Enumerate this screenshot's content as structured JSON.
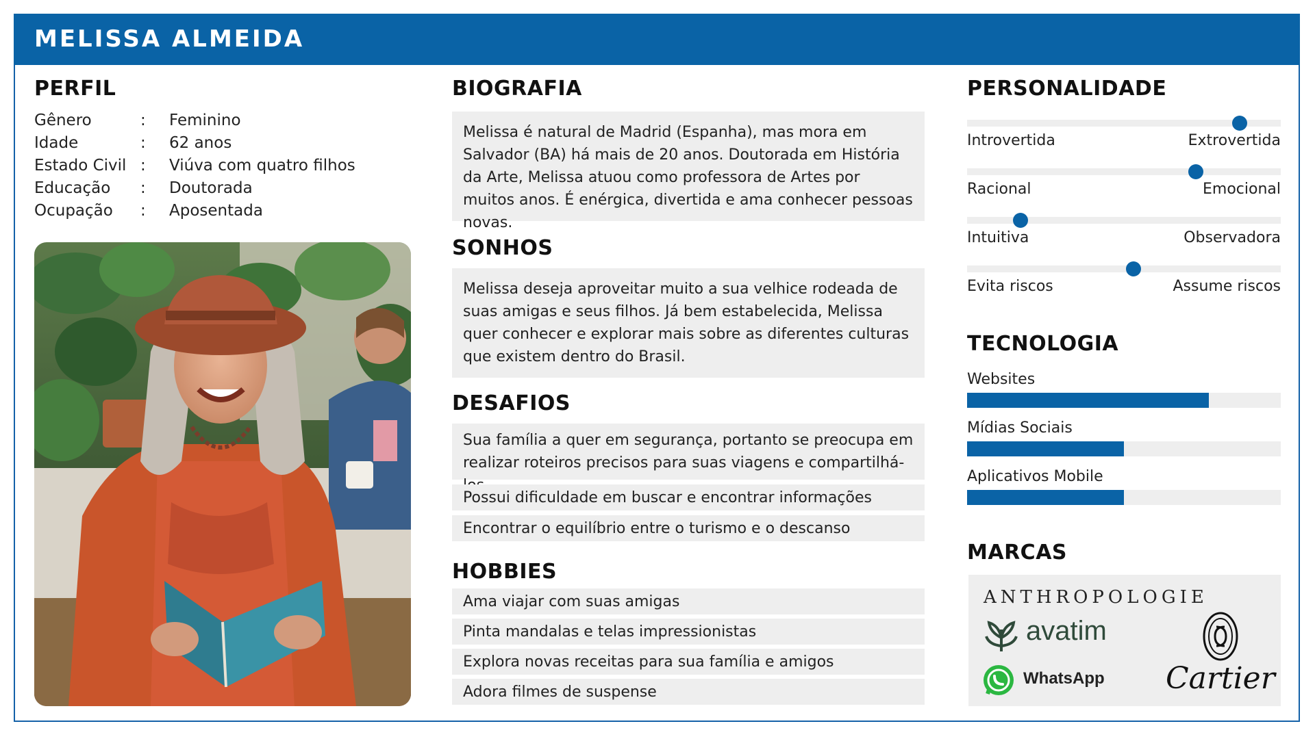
{
  "persona": {
    "name": "MELISSA ALMEIDA"
  },
  "profile": {
    "title": "PERFIL",
    "rows": [
      {
        "label": "Gênero",
        "colon": ":",
        "value": "Feminino"
      },
      {
        "label": "Idade",
        "colon": ":",
        "value": "62 anos"
      },
      {
        "label": "Estado Civil",
        "colon": ":",
        "value": "Viúva com quatro filhos"
      },
      {
        "label": "Educação",
        "colon": ":",
        "value": "Doutorada"
      },
      {
        "label": "Ocupação",
        "colon": ":",
        "value": "Aposentada"
      }
    ]
  },
  "biography": {
    "title": "BIOGRAFIA",
    "text": "Melissa é natural de Madrid (Espanha), mas mora em Salvador (BA) há mais de 20 anos. Doutorada em História da Arte, Melissa atuou como professora de Artes por muitos anos. É enérgica, divertida e ama conhecer pessoas novas."
  },
  "dreams": {
    "title": "SONHOS",
    "text": "Melissa deseja aproveitar muito a sua velhice rodeada de suas amigas e seus filhos. Já bem estabelecida, Melissa quer conhecer e explorar mais sobre as diferentes culturas que existem dentro do Brasil."
  },
  "challenges": {
    "title": "DESAFIOS",
    "items": [
      "Sua família a quer em segurança, portanto se preocupa em realizar roteiros precisos para suas viagens e compartilhá-los",
      "Possui dificuldade em buscar e encontrar informações",
      "Encontrar o equilíbrio entre o turismo e o descanso"
    ]
  },
  "hobbies": {
    "title": "HOBBIES",
    "items": [
      "Ama viajar com suas amigas",
      "Pinta mandalas e telas impressionistas",
      "Explora novas receitas para sua família e amigos",
      "Adora filmes de suspense"
    ]
  },
  "personality": {
    "title": "PERSONALIDADE",
    "traits": [
      {
        "left": "Introvertida",
        "right": "Extrovertida",
        "level": 0.87
      },
      {
        "left": "Racional",
        "right": "Emocional",
        "level": 0.73
      },
      {
        "left": "Intuitiva",
        "right": "Observadora",
        "level": 0.17
      },
      {
        "left": "Evita riscos",
        "right": "Assume riscos",
        "level": 0.53
      }
    ]
  },
  "technology": {
    "title": "TECNOLOGIA",
    "items": [
      {
        "label": "Websites",
        "level": 0.77
      },
      {
        "label": "Mídias Sociais",
        "level": 0.5
      },
      {
        "label": "Aplicativos Mobile",
        "level": 0.5
      }
    ]
  },
  "brands": {
    "title": "MARCAS",
    "logos": [
      "ANTHROPOLOGIE",
      "avatim",
      "WhatsApp",
      "Cartier"
    ]
  },
  "colors": {
    "primary": "#0a63a6",
    "panel": "#eeeeee"
  }
}
